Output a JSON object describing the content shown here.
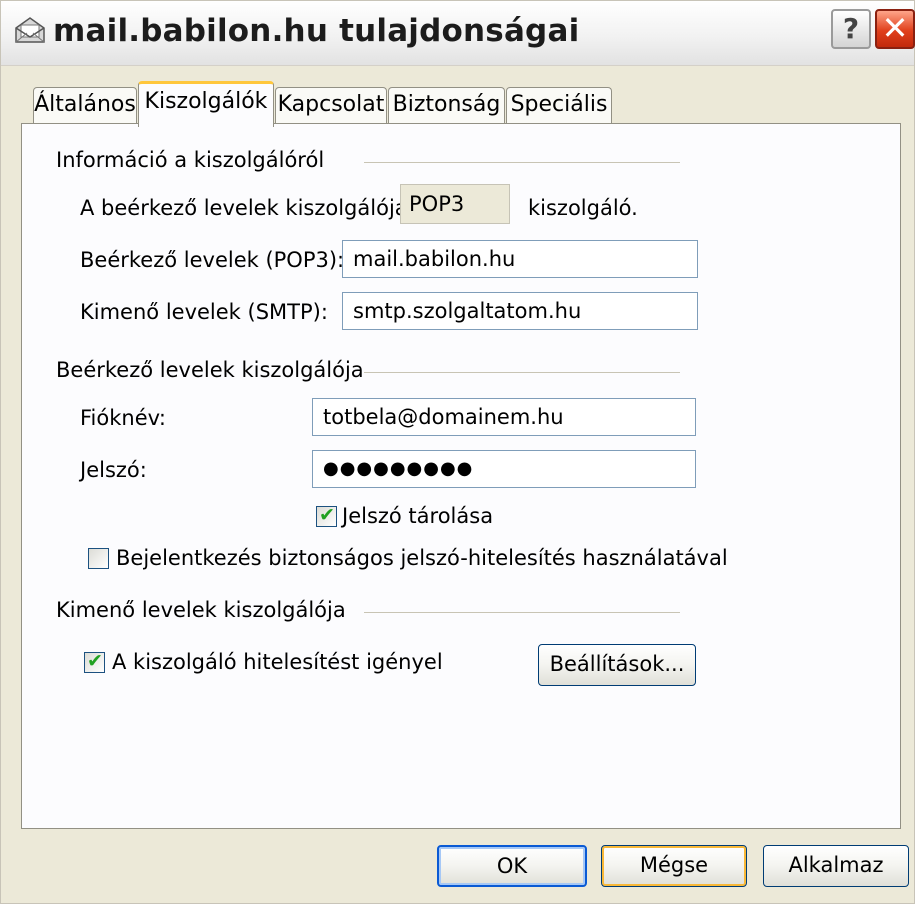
{
  "window": {
    "title": "mail.babilon.hu tulajdonságai",
    "help_label": "?",
    "close_label": "✕"
  },
  "tabs": [
    {
      "label": "Általános",
      "active": false
    },
    {
      "label": "Kiszolgálók",
      "active": true
    },
    {
      "label": "Kapcsolat",
      "active": false
    },
    {
      "label": "Biztonság",
      "active": false
    },
    {
      "label": "Speciális",
      "active": false
    }
  ],
  "server_info": {
    "group_title": "Információ a kiszolgálóról",
    "incoming_type_label": "A beérkező levelek kiszolgálója",
    "incoming_type_value": "POP3",
    "incoming_type_suffix": "kiszolgáló.",
    "incoming_label": "Beérkező levelek (POP3):",
    "incoming_value": "mail.babilon.hu",
    "outgoing_label": "Kimenő levelek (SMTP):",
    "outgoing_value": "smtp.szolgaltatom.hu"
  },
  "incoming_server": {
    "group_title": "Beérkező levelek kiszolgálója",
    "account_label": "Fióknév:",
    "account_value": "totbela@domainem.hu",
    "password_label": "Jelszó:",
    "password_value": "●●●●●●●●●",
    "remember_password_label": "Jelszó tárolása",
    "remember_password_checked": true,
    "spa_label": "Bejelentkezés biztonságos jelszó-hitelesítés használatával",
    "spa_checked": false
  },
  "outgoing_server": {
    "group_title": "Kimenő levelek kiszolgálója",
    "auth_required_label": "A kiszolgáló hitelesítést igényel",
    "auth_required_checked": true,
    "settings_button": "Beállítások..."
  },
  "buttons": {
    "ok": "OK",
    "cancel": "Mégse",
    "apply": "Alkalmaz"
  },
  "colors": {
    "dialog_bg": "#ece9d8",
    "panel_bg": "#fcfcfe",
    "active_tab_accent": "#ffc73c",
    "close_button": "#e0401c",
    "checkmark": "#21a121"
  }
}
